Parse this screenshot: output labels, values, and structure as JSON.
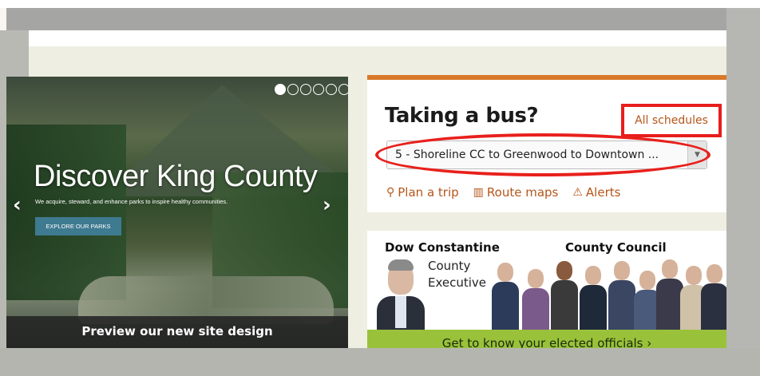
{
  "hero": {
    "dots_total": 6,
    "active_dot": 0,
    "title": "Discover King County",
    "subtitle": "We acquire, steward, and enhance parks to inspire healthy communities.",
    "cta_label": "EXPLORE OUR PARKS",
    "prev_arrow": "‹",
    "next_arrow": "›",
    "preview_text": "Preview our new site design"
  },
  "bus": {
    "title": "Taking a bus?",
    "all_schedules": "All schedules",
    "selected_route": "5 - Shoreline CC to Greenwood to Downtown ...",
    "links": [
      {
        "icon": "map-pin-icon",
        "label": "Plan a trip"
      },
      {
        "icon": "map-icon",
        "label": "Route maps"
      },
      {
        "icon": "warning-icon",
        "label": "Alerts"
      }
    ],
    "accent_color": "#d8792a",
    "link_color": "#b5561a",
    "highlight_color": "#e81d1d"
  },
  "officials": {
    "executive_name": "Dow Constantine",
    "executive_role_line1": "County",
    "executive_role_line2": "Executive",
    "council_label": "County Council",
    "cta": "Get to know your elected officials ›",
    "cta_color": "#99c23a"
  }
}
